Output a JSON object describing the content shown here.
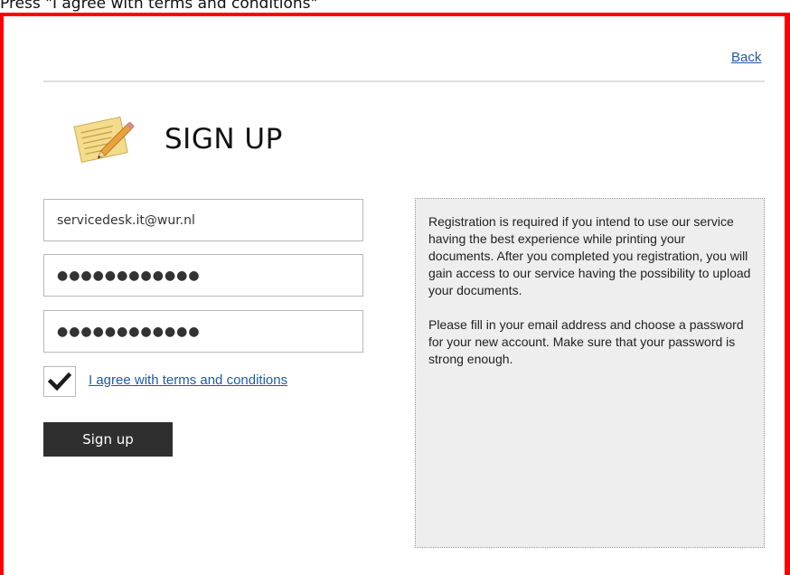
{
  "instruction": "Press \"I agree with terms and conditions\"",
  "header": {
    "back_label": "Back"
  },
  "form": {
    "title": "SIGN UP",
    "email_value": "servicedesk.it@wur.nl",
    "password_value": "●●●●●●●●●●●●",
    "confirm_password_value": "●●●●●●●●●●●●",
    "agree_checked": true,
    "agree_label": "I agree with terms and conditions",
    "submit_label": "Sign up"
  },
  "info": {
    "paragraph_1": "Registration is required if you intend to use our service having the best experience while printing your documents. After you completed you registration, you will gain access to our service having the possibility to upload your documents.",
    "paragraph_2": "Please fill in your email address and choose a password for your new account. Make sure that your password is strong enough."
  },
  "icons": {
    "logo": "notepad-pencil-icon",
    "checkbox": "checkmark-icon"
  },
  "colors": {
    "frame": "#ff0000",
    "link": "#1f5ba8",
    "button": "#2f2f2f",
    "panel": "#eeeeee"
  }
}
